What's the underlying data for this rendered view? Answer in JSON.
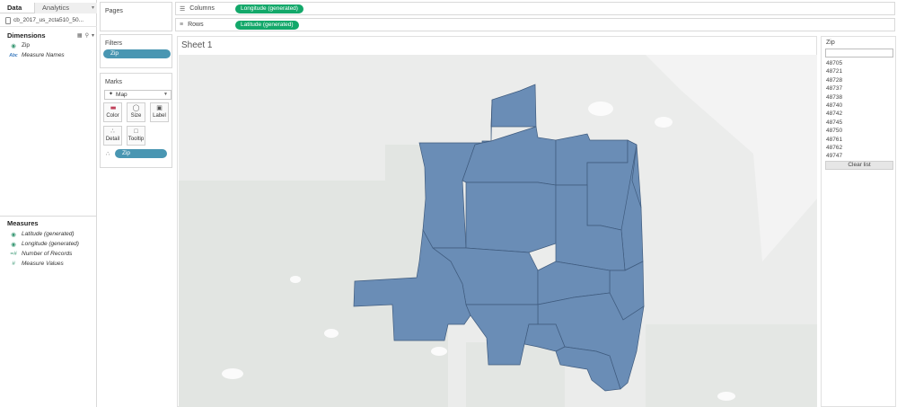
{
  "data_pane": {
    "tabs": [
      {
        "label": "Data"
      },
      {
        "label": "Analytics"
      }
    ],
    "datasource": "cb_2017_us_zcta510_50...",
    "dimensions": {
      "title": "Dimensions",
      "fields": [
        {
          "label": "Zip",
          "icon": "globe-icon"
        },
        {
          "label": "Measure Names",
          "icon": "abc-icon"
        }
      ]
    },
    "measures": {
      "title": "Measures",
      "fields": [
        {
          "label": "Latitude (generated)",
          "icon": "globe-icon"
        },
        {
          "label": "Longitude (generated)",
          "icon": "globe-icon"
        },
        {
          "label": "Number of Records",
          "icon": "hash-icon"
        },
        {
          "label": "Measure Values",
          "icon": "hash-icon"
        }
      ]
    }
  },
  "cards": {
    "pages": {
      "title": "Pages"
    },
    "filters": {
      "title": "Filters",
      "pill": "Zip"
    },
    "marks": {
      "title": "Marks",
      "mark_type": "Map",
      "buttons": [
        {
          "label": "Color",
          "icon": "color-icon"
        },
        {
          "label": "Size",
          "icon": "size-icon"
        },
        {
          "label": "Label",
          "icon": "label-icon"
        },
        {
          "label": "Detail",
          "icon": "detail-icon"
        },
        {
          "label": "Tooltip",
          "icon": "tooltip-icon"
        }
      ],
      "detail_pill": "Zip"
    }
  },
  "shelves": {
    "columns": {
      "label": "Columns",
      "pill": "Longitude (generated)"
    },
    "rows": {
      "label": "Rows",
      "pill": "Latitude (generated)"
    }
  },
  "sheet": {
    "title": "Sheet 1",
    "region_fill": "#6a8db6",
    "region_border": "#3f5b7e"
  },
  "zip_filter": {
    "title": "Zip",
    "search_value": "",
    "items": [
      "48705",
      "48721",
      "48728",
      "48737",
      "48738",
      "48740",
      "48742",
      "48745",
      "48750",
      "48761",
      "48762",
      "49747"
    ],
    "clear_label": "Clear list"
  },
  "colors": {
    "blue_pill": "#4996b2",
    "green_pill": "#13a86a"
  }
}
